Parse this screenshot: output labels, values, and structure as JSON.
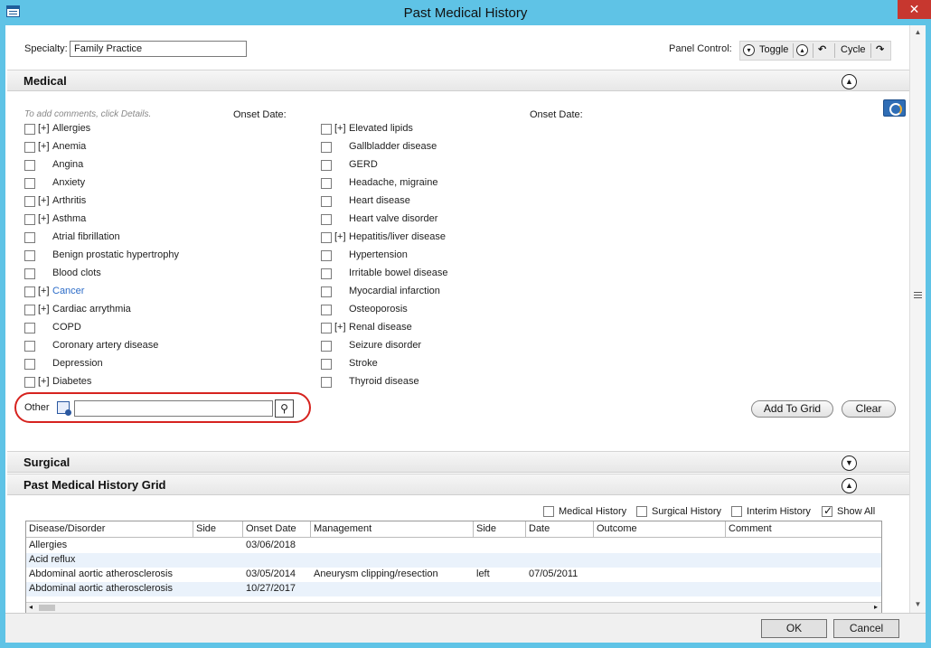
{
  "window": {
    "title": "Past Medical History",
    "close": "✕"
  },
  "specialty": {
    "label": "Specialty:",
    "value": "Family Practice"
  },
  "panel_control": {
    "label": "Panel Control:",
    "toggle": "Toggle",
    "cycle": "Cycle"
  },
  "sections": {
    "medical": "Medical",
    "surgical": "Surgical",
    "grid": "Past Medical History Grid"
  },
  "hint": "To add comments, click Details.",
  "onset_label": "Onset Date:",
  "conditions_left": [
    {
      "expand": "[+]",
      "label": "Allergies"
    },
    {
      "expand": "[+]",
      "label": "Anemia"
    },
    {
      "expand": "",
      "label": "Angina"
    },
    {
      "expand": "",
      "label": "Anxiety"
    },
    {
      "expand": "[+]",
      "label": "Arthritis"
    },
    {
      "expand": "[+]",
      "label": "Asthma"
    },
    {
      "expand": "",
      "label": "Atrial fibrillation"
    },
    {
      "expand": "",
      "label": "Benign prostatic hypertrophy"
    },
    {
      "expand": "",
      "label": "Blood clots"
    },
    {
      "expand": "[+]",
      "label": "Cancer"
    },
    {
      "expand": "[+]",
      "label": "Cardiac arrythmia"
    },
    {
      "expand": "",
      "label": "COPD"
    },
    {
      "expand": "",
      "label": "Coronary artery disease"
    },
    {
      "expand": "",
      "label": "Depression"
    },
    {
      "expand": "[+]",
      "label": "Diabetes"
    }
  ],
  "conditions_right": [
    {
      "expand": "[+]",
      "label": "Elevated lipids"
    },
    {
      "expand": "",
      "label": "Gallbladder disease"
    },
    {
      "expand": "",
      "label": "GERD"
    },
    {
      "expand": "",
      "label": "Headache, migraine"
    },
    {
      "expand": "",
      "label": "Heart disease"
    },
    {
      "expand": "",
      "label": "Heart valve disorder"
    },
    {
      "expand": "[+]",
      "label": "Hepatitis/liver disease"
    },
    {
      "expand": "",
      "label": "Hypertension"
    },
    {
      "expand": "",
      "label": "Irritable bowel disease"
    },
    {
      "expand": "",
      "label": "Myocardial infarction"
    },
    {
      "expand": "",
      "label": "Osteoporosis"
    },
    {
      "expand": "[+]",
      "label": "Renal disease"
    },
    {
      "expand": "",
      "label": "Seizure disorder"
    },
    {
      "expand": "",
      "label": "Stroke"
    },
    {
      "expand": "",
      "label": "Thyroid disease"
    }
  ],
  "other": {
    "label": "Other",
    "value": ""
  },
  "buttons": {
    "add_to_grid": "Add To Grid",
    "clear": "Clear",
    "ok": "OK",
    "cancel": "Cancel"
  },
  "filters": [
    {
      "label": "Medical History",
      "checked": false
    },
    {
      "label": "Surgical History",
      "checked": false
    },
    {
      "label": "Interim History",
      "checked": false
    },
    {
      "label": "Show All",
      "checked": true
    }
  ],
  "grid": {
    "columns": [
      "Disease/Disorder",
      "Side",
      "Onset Date",
      "Management",
      "Side",
      "Date",
      "Outcome",
      "Comment"
    ],
    "rows": [
      [
        "Allergies",
        "",
        "03/06/2018",
        "",
        "",
        "",
        "",
        ""
      ],
      [
        "Acid reflux",
        "",
        "",
        "",
        "",
        "",
        "",
        ""
      ],
      [
        "Abdominal aortic atherosclerosis",
        "",
        "03/05/2014",
        "Aneurysm clipping/resection",
        "left",
        "07/05/2011",
        "",
        ""
      ],
      [
        "Abdominal aortic atherosclerosis",
        "",
        "10/27/2017",
        "",
        "",
        "",
        "",
        ""
      ]
    ]
  },
  "colors": {
    "titlebar": "#5fc3e6",
    "close": "#c7372f",
    "link": "#2c6cc8",
    "highlight": "#d6231f"
  }
}
